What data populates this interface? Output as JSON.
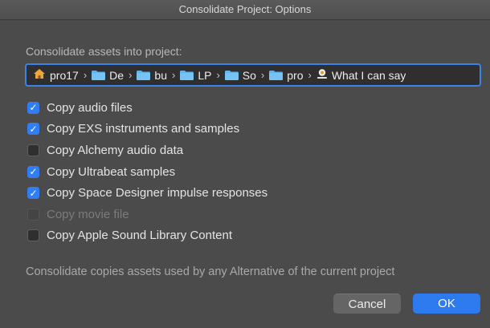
{
  "window": {
    "title": "Consolidate Project: Options"
  },
  "section_label": "Consolidate assets into project:",
  "path": {
    "crumbs": [
      {
        "icon": "home-icon",
        "label": "pro17"
      },
      {
        "icon": "folder-icon",
        "label": "De"
      },
      {
        "icon": "folder-icon",
        "label": "bu"
      },
      {
        "icon": "folder-icon",
        "label": "LP"
      },
      {
        "icon": "folder-icon",
        "label": "So"
      },
      {
        "icon": "folder-icon",
        "label": "pro"
      },
      {
        "icon": "logic-song-icon",
        "label": "What I can say"
      }
    ],
    "separator": "›"
  },
  "options": [
    {
      "label": "Copy audio files",
      "checked": true,
      "enabled": true
    },
    {
      "label": "Copy EXS instruments and samples",
      "checked": true,
      "enabled": true
    },
    {
      "label": "Copy Alchemy audio data",
      "checked": false,
      "enabled": true
    },
    {
      "label": "Copy Ultrabeat samples",
      "checked": true,
      "enabled": true
    },
    {
      "label": "Copy Space Designer impulse responses",
      "checked": true,
      "enabled": true
    },
    {
      "label": "Copy movie file",
      "checked": false,
      "enabled": false
    },
    {
      "label": "Copy Apple Sound Library Content",
      "checked": false,
      "enabled": true
    }
  ],
  "footer_note": "Consolidate copies assets used by any Alternative of the current project",
  "buttons": {
    "cancel": "Cancel",
    "ok": "OK"
  },
  "colors": {
    "accent": "#2f7ef6",
    "focus_ring": "#3c82e8",
    "folder": "#5fb4f0",
    "home": "#f2a33a"
  }
}
